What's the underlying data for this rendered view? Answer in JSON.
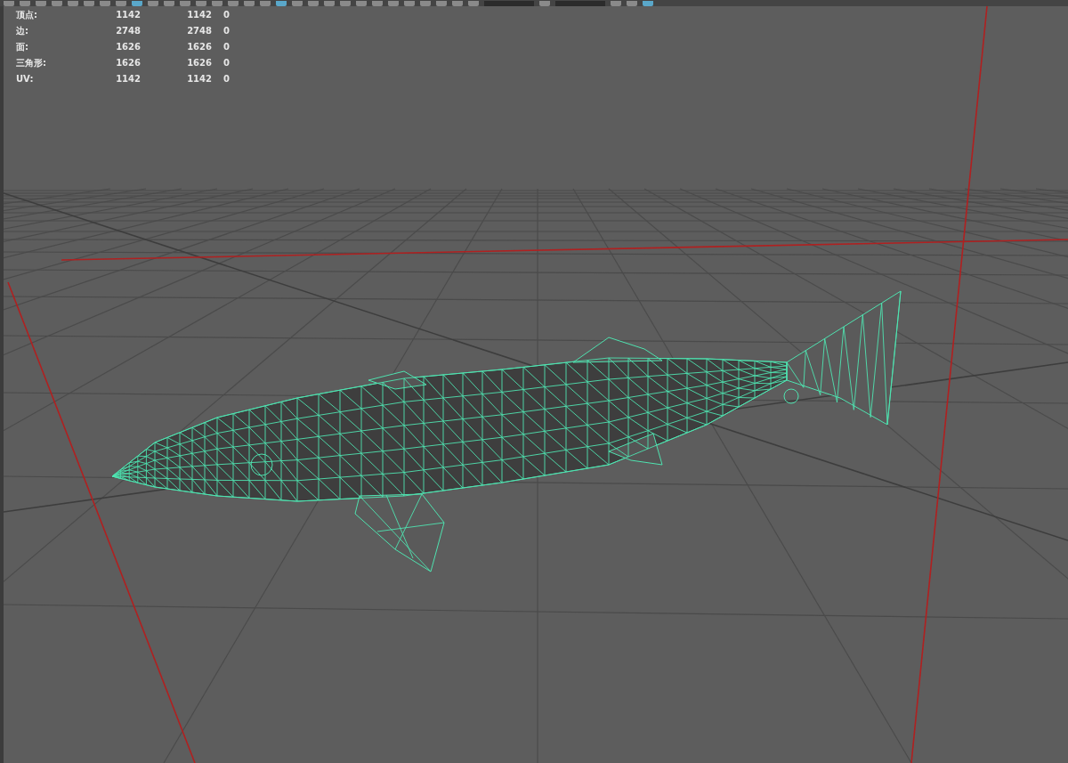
{
  "stats": [
    {
      "label": "顶点:",
      "values": [
        "1142",
        "1142",
        "0"
      ]
    },
    {
      "label": "边:",
      "values": [
        "2748",
        "2748",
        "0"
      ]
    },
    {
      "label": "面:",
      "values": [
        "1626",
        "1626",
        "0"
      ]
    },
    {
      "label": "三角形:",
      "values": [
        "1626",
        "1626",
        "0"
      ]
    },
    {
      "label": "UV:",
      "values": [
        "1142",
        "1142",
        "0"
      ]
    }
  ]
}
